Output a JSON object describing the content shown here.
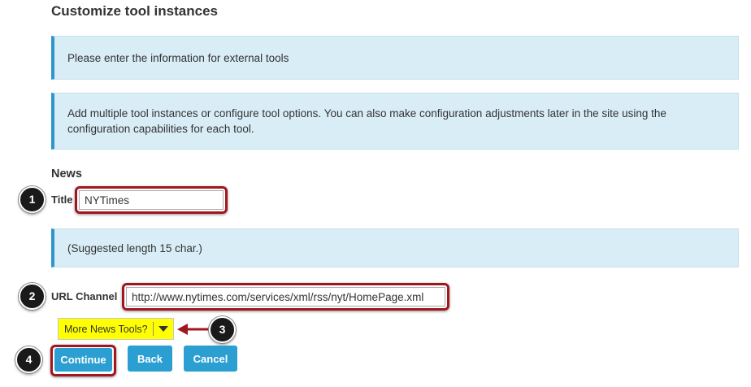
{
  "page": {
    "title": "Customize tool instances"
  },
  "messages": {
    "external_tools": "Please enter the information for external tools",
    "multiple_instances": "Add multiple tool instances or configure tool options. You can also make configuration adjustments later in the site using the configuration capabilities for each tool.",
    "suggested_length": "(Suggested length 15 char.)"
  },
  "news": {
    "heading": "News",
    "title_label": "Title",
    "title_value": "NYTimes",
    "url_label": "URL Channel",
    "url_value": "http://www.nytimes.com/services/xml/rss/nyt/HomePage.xml",
    "more_tools_selected": "More News Tools?"
  },
  "callouts": [
    "1",
    "2",
    "3",
    "4"
  ],
  "buttons": {
    "continue": "Continue",
    "back": "Back",
    "cancel": "Cancel"
  },
  "colors": {
    "info_background": "#d9edf7",
    "info_accent": "#2d96cf",
    "button": "#2b9fd1",
    "highlight": "#a0171e",
    "select_highlight": "#ffff00"
  }
}
